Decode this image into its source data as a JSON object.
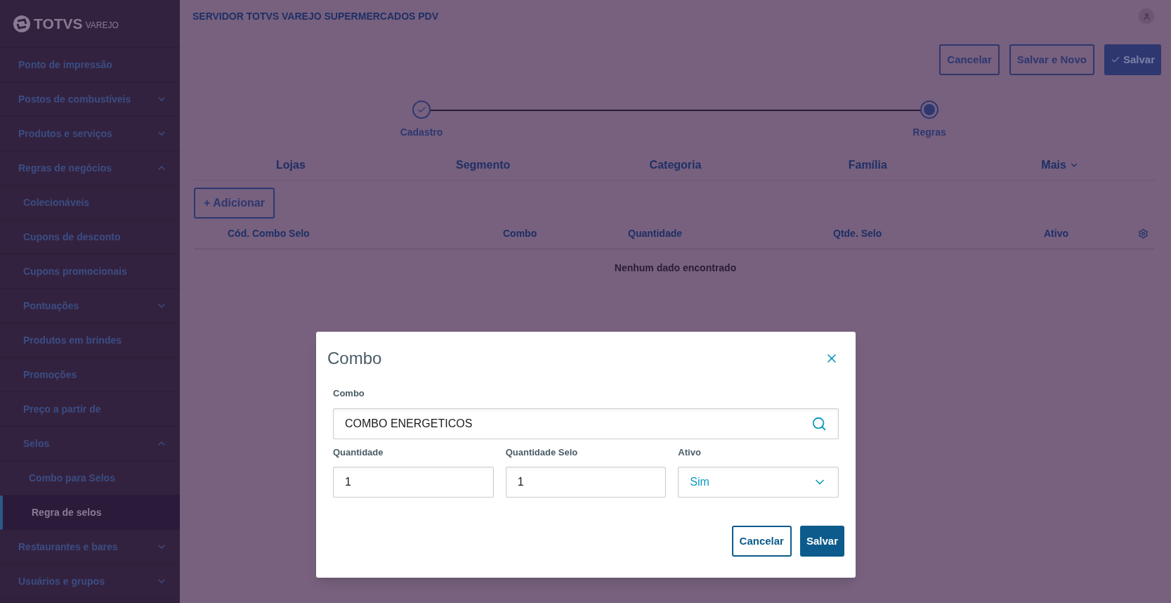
{
  "brand": {
    "name": "TOTVS",
    "product": "VAREJO"
  },
  "sidebar": {
    "items": [
      {
        "label": "Ponto de impressão",
        "selected": false
      },
      {
        "label": "Postos de combustíveis",
        "selected": false,
        "expanded": false
      },
      {
        "label": "Produtos e serviços",
        "selected": false,
        "expanded": false
      },
      {
        "label": "Regras de negócios",
        "selected": false,
        "expanded": true,
        "children": [
          {
            "label": "Colecionáveis",
            "selected": false
          },
          {
            "label": "Cupons de desconto",
            "selected": false
          },
          {
            "label": "Cupons promocionais",
            "selected": false
          },
          {
            "label": "Pontuações",
            "selected": false,
            "expanded": false
          },
          {
            "label": "Produtos em brindes",
            "selected": false
          },
          {
            "label": "Promoções",
            "selected": false
          },
          {
            "label": "Preço a partir de",
            "selected": false
          },
          {
            "label": "Selos",
            "selected": false,
            "expanded": true,
            "children": [
              {
                "label": "Combo para Selos",
                "selected": false
              },
              {
                "label": "Regra de selos",
                "selected": true
              }
            ]
          }
        ]
      },
      {
        "label": "Restaurantes e bares",
        "selected": false,
        "expanded": false
      },
      {
        "label": "Usuários e grupos",
        "selected": false,
        "expanded": false
      }
    ]
  },
  "header": {
    "title": "SERVIDOR TOTVS VAREJO SUPERMERCADOS PDV"
  },
  "actions": [
    {
      "label": "Cancelar",
      "kind": "secondary"
    },
    {
      "label": "Salvar e Novo",
      "kind": "secondary"
    },
    {
      "label": "Salvar",
      "kind": "primary"
    }
  ],
  "stepper": [
    {
      "label": "Cadastro",
      "completed": true
    },
    {
      "label": "Regras",
      "completed": false
    }
  ],
  "tabs": [
    {
      "label": "Lojas",
      "kind": "tab"
    },
    {
      "label": "Segmento",
      "kind": "tab"
    },
    {
      "label": "Categoria",
      "kind": "tab"
    },
    {
      "label": "Família",
      "kind": "tab"
    },
    {
      "label": "Mais",
      "kind": "menu"
    }
  ],
  "add_button": {
    "label": "+ Adicionar"
  },
  "table": {
    "columns": [
      "Cód. Combo Selo",
      "Combo",
      "Quantidade",
      "Qtde. Selo",
      "Ativo"
    ],
    "empty_message": "Nenhum dado encontrado"
  },
  "dialog": {
    "title": "Combo",
    "fields": [
      {
        "label": "Combo",
        "value": "COMBO ENERGETICOS",
        "kind": "search"
      }
    ],
    "row_fields": [
      {
        "label": "Quantidade",
        "value": "1",
        "kind": "text"
      },
      {
        "label": "Quantidade Selo",
        "value": "1",
        "kind": "text"
      },
      {
        "label": "Ativo",
        "value": "Sim",
        "kind": "select"
      }
    ],
    "buttons": [
      {
        "label": "Cancelar",
        "kind": "secondary"
      },
      {
        "label": "Salvar",
        "kind": "primary"
      }
    ]
  }
}
